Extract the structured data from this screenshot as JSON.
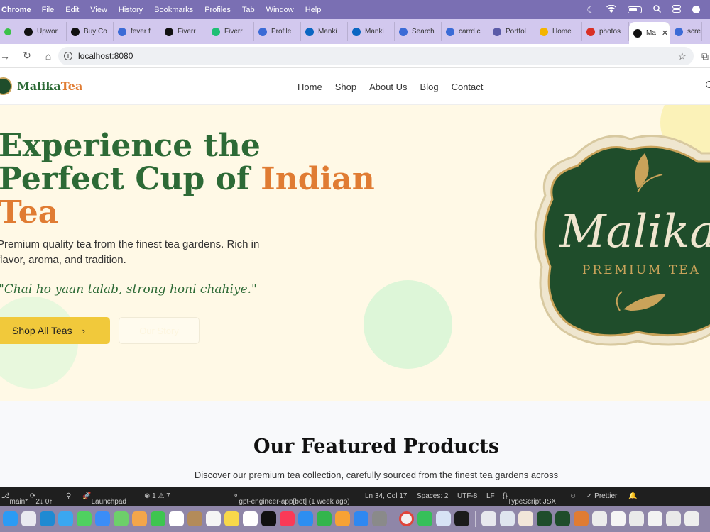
{
  "menubar": {
    "app": "Chrome",
    "items": [
      "File",
      "Edit",
      "View",
      "History",
      "Bookmarks",
      "Profiles",
      "Tab",
      "Window",
      "Help"
    ]
  },
  "tabs": [
    {
      "label": "Upwor",
      "fav": "up",
      "color": "#111111"
    },
    {
      "label": "Buy Co",
      "fav": "up",
      "color": "#111111"
    },
    {
      "label": "fever f",
      "fav": "search",
      "color": "#3b6bd6"
    },
    {
      "label": "Fiverr",
      "fav": "fiverr",
      "color": "#111111"
    },
    {
      "label": "Fiverr",
      "fav": "f",
      "color": "#1dbf73"
    },
    {
      "label": "Profile",
      "fav": "k",
      "color": "#3b6bd6"
    },
    {
      "label": "Manki",
      "fav": "in",
      "color": "#0a66c2"
    },
    {
      "label": "Manki",
      "fav": "in",
      "color": "#0a66c2"
    },
    {
      "label": "Search",
      "fav": "search",
      "color": "#3b6bd6"
    },
    {
      "label": "carrd.c",
      "fav": "search",
      "color": "#3b6bd6"
    },
    {
      "label": "Portfol",
      "fav": "p",
      "color": "#5b5ba8"
    },
    {
      "label": "Home",
      "fav": "drive",
      "color": "#f4b400"
    },
    {
      "label": "photos",
      "fav": "m",
      "color": "#d93025"
    },
    {
      "label": "Ma",
      "fav": "heart",
      "color": "#111111",
      "active": true
    },
    {
      "label": "scre",
      "fav": "search",
      "color": "#3b6bd6"
    }
  ],
  "address": {
    "url": "localhost:8080"
  },
  "site": {
    "brand_main": "Malika",
    "brand_accent": "Tea",
    "nav": [
      "Home",
      "Shop",
      "About Us",
      "Blog",
      "Contact"
    ]
  },
  "hero": {
    "headline_line1": "Experience the",
    "headline_line2": "Perfect Cup of ",
    "headline_accent1": "Indian",
    "headline_accent2": "Tea",
    "subtext": "Premium quality tea from the finest tea gardens. Rich in flavor, aroma, and tradition.",
    "quote": "\"Chai ho yaan talab, strong honi chahiye.\"",
    "primary_button": "Shop All Teas",
    "secondary_button": "Our Story"
  },
  "label_art": {
    "title": "Malika",
    "subtitle": "PREMIUM TEA"
  },
  "featured": {
    "title": "Our Featured Products",
    "description": "Discover our premium tea collection, carefully sourced from the finest tea gardens across"
  },
  "statusbar": {
    "branch": "main*",
    "sync": "2↓ 0↑",
    "launchpad": "Launchpad",
    "problems": "⊗ 1 ⚠ 7",
    "blame": "gpt-engineer-app[bot] (1 week ago)",
    "position": "Ln 34, Col 17",
    "spaces": "Spaces: 2",
    "encoding": "UTF-8",
    "eol": "LF",
    "language": "TypeScript JSX",
    "formatter": "✓ Prettier"
  },
  "colors": {
    "green": "#2d6a36",
    "orange": "#e07c33",
    "yellow": "#f1c93b",
    "hero_bg": "#fff9e6"
  }
}
